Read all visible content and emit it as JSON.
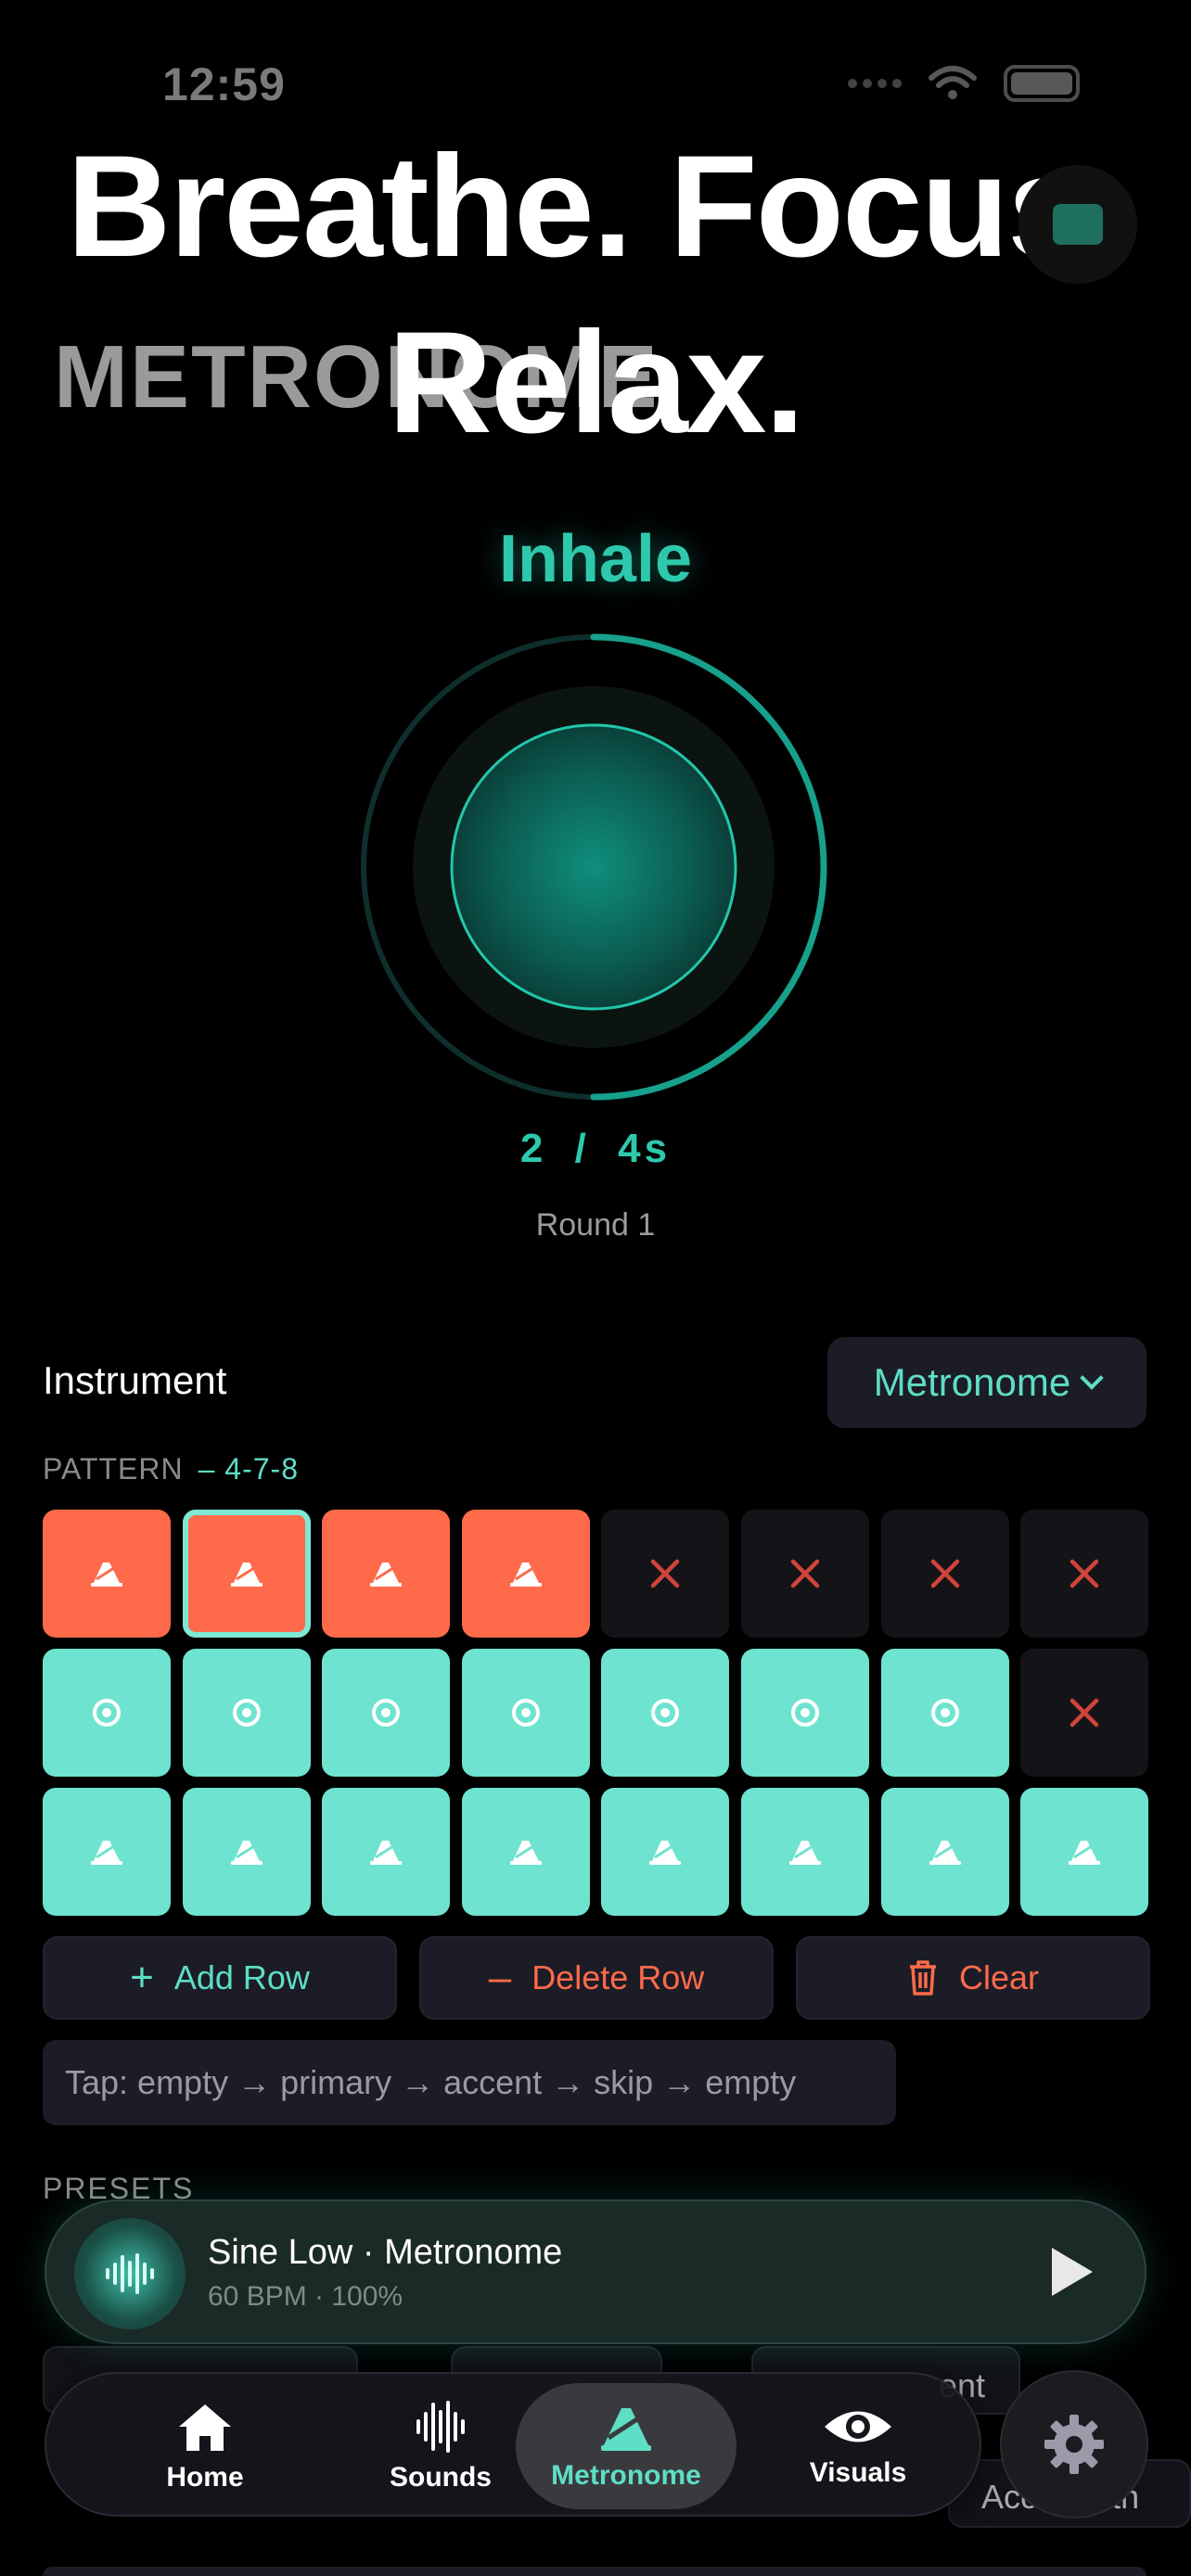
{
  "status": {
    "time": "12:59"
  },
  "header": {
    "section_title": "METRONOME",
    "hero_line1": "Breathe. Focus.",
    "hero_line2": "Relax."
  },
  "session": {
    "phase": "Inhale",
    "elapsed": "2",
    "separator": "/",
    "duration": "4s",
    "round_label": "Round 1",
    "progress": 0.5
  },
  "instrument": {
    "label": "Instrument",
    "selected": "Metronome"
  },
  "pattern": {
    "label": "PATTERN",
    "name": "– 4-7-8",
    "rows": [
      [
        "accent",
        "accent",
        "accent",
        "accent",
        "skip",
        "skip",
        "skip",
        "skip"
      ],
      [
        "primary",
        "primary",
        "primary",
        "primary",
        "primary",
        "primary",
        "primary",
        "skip"
      ],
      [
        "metronome",
        "metronome",
        "metronome",
        "metronome",
        "metronome",
        "metronome",
        "metronome",
        "metronome"
      ]
    ],
    "selected_cell": [
      0,
      1
    ]
  },
  "actions": {
    "add_row": "Add Row",
    "delete_row": "Delete Row",
    "clear": "Clear"
  },
  "hint": "Tap: empty → primary → accent → skip → empty",
  "presets": {
    "label": "PRESETS",
    "partial_ent": "ent",
    "partial_accel": "Acceleroth"
  },
  "now_playing": {
    "title": "Sine Low · Metronome",
    "subtitle": "60 BPM · 100%"
  },
  "tabs": [
    {
      "label": "Home",
      "icon": "home-icon"
    },
    {
      "label": "Sounds",
      "icon": "waveform-icon"
    },
    {
      "label": "Metronome",
      "icon": "metronome-icon"
    },
    {
      "label": "Visuals",
      "icon": "eye-icon"
    }
  ],
  "colors": {
    "accent_teal": "#2ec8ad",
    "pattern_orange": "#ff6a4a",
    "pattern_teal": "#6ee3cf",
    "panel": "#1c1c26"
  }
}
